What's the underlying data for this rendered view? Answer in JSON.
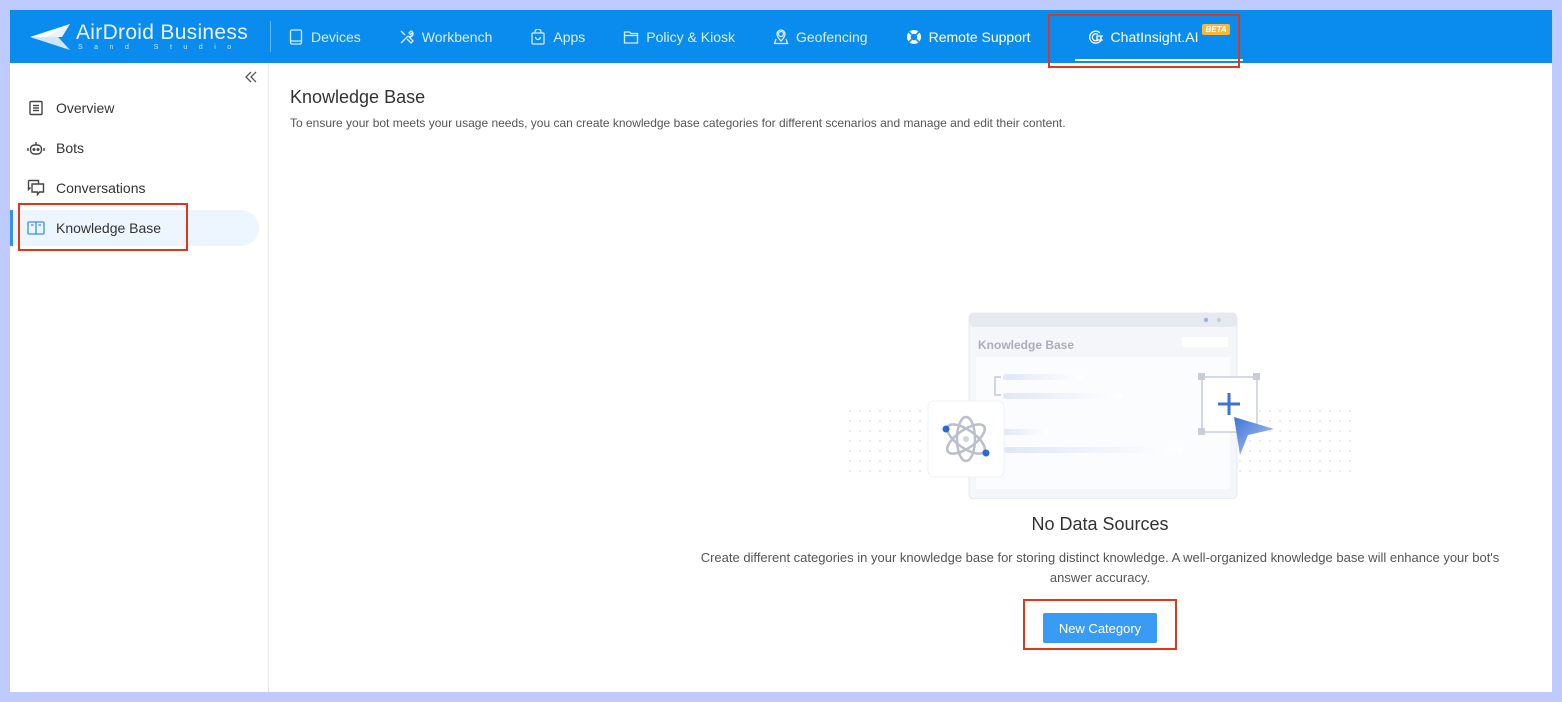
{
  "brand": {
    "name": "AirDroid Business",
    "sub": "Sand Studio"
  },
  "nav": {
    "items": [
      {
        "label": "Devices",
        "icon": "tablet-icon"
      },
      {
        "label": "Workbench",
        "icon": "tools-icon"
      },
      {
        "label": "Apps",
        "icon": "shopping-bag-icon"
      },
      {
        "label": "Policy & Kiosk",
        "icon": "folder-icon"
      },
      {
        "label": "Geofencing",
        "icon": "map-pin-icon"
      },
      {
        "label": "Remote Support",
        "icon": "lifebuoy-icon"
      },
      {
        "label": "ChatInsight.AI",
        "icon": "chat-bot-icon",
        "badge": "BETA",
        "active": true
      }
    ]
  },
  "sidebar": {
    "collapse_icon": "double-chevron-left-icon",
    "items": [
      {
        "label": "Overview",
        "icon": "document-icon"
      },
      {
        "label": "Bots",
        "icon": "robot-icon"
      },
      {
        "label": "Conversations",
        "icon": "chat-bubbles-icon"
      },
      {
        "label": "Knowledge Base",
        "icon": "book-icon",
        "active": true
      }
    ]
  },
  "main": {
    "title": "Knowledge Base",
    "description": "To ensure your bot meets your usage needs, you can create knowledge base categories for different scenarios and manage and edit their content.",
    "illustration": {
      "window_title": "Knowledge Base"
    },
    "empty_state": {
      "title": "No Data Sources",
      "description": "Create different categories in your knowledge base for storing distinct knowledge. A well-organized knowledge base will enhance your bot's answer accuracy.",
      "button_label": "New Category"
    }
  },
  "colors": {
    "topbar": "#0a8cee",
    "accent": "#3a9bf5",
    "highlight": "#e0371c",
    "badge": "#f6b73c",
    "frame": "#bfcbff"
  }
}
